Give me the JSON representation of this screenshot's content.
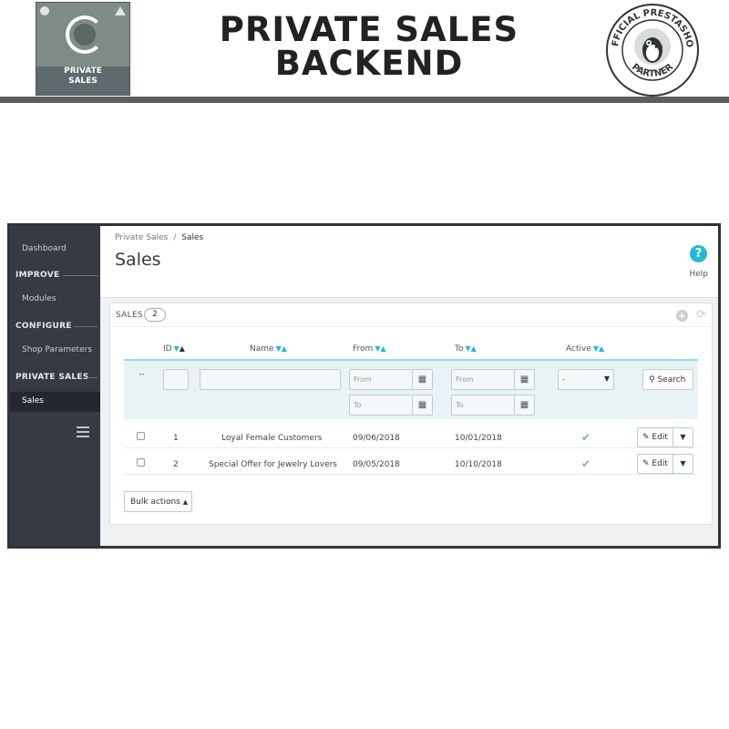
{
  "banner": {
    "logo_text_line1": "PRIVATE",
    "logo_text_line2": "SALES",
    "title_line1": "PRIVATE SALES",
    "title_line2": "BACKEND",
    "partner_text_top": "OFFICIAL PRESTASHOP",
    "partner_text_bottom": "PARTNER"
  },
  "sidebar": {
    "dashboard": "Dashboard",
    "improve": "IMPROVE",
    "modules": "Modules",
    "configure": "CONFIGURE",
    "shop_parameters": "Shop Parameters",
    "private_sales": "PRIVATE SALES",
    "sales": "Sales"
  },
  "header": {
    "breadcrumb_parent": "Private Sales",
    "breadcrumb_sep": "/",
    "breadcrumb_current": "Sales",
    "title": "Sales",
    "help_label": "Help"
  },
  "panel": {
    "title": "SALES",
    "count": "2",
    "columns": {
      "id": "ID",
      "name": "Name",
      "from": "From",
      "to": "To",
      "active": "Active"
    },
    "filters": {
      "dash": "--",
      "from_placeholder": "From",
      "to_placeholder": "To",
      "active_value": "-",
      "search_label": "Search"
    },
    "rows": [
      {
        "id": "1",
        "name": "Loyal Female Customers",
        "from": "09/06/2018",
        "to": "10/01/2018",
        "active": true,
        "edit": "Edit"
      },
      {
        "id": "2",
        "name": "Special Offer for Jewelry Lovers",
        "from": "09/05/2018",
        "to": "10/10/2018",
        "active": true,
        "edit": "Edit"
      }
    ],
    "bulk_actions": "Bulk actions"
  },
  "colors": {
    "accent": "#25b9d7",
    "sidebar": "#363a41",
    "active_check": "#72c279"
  }
}
